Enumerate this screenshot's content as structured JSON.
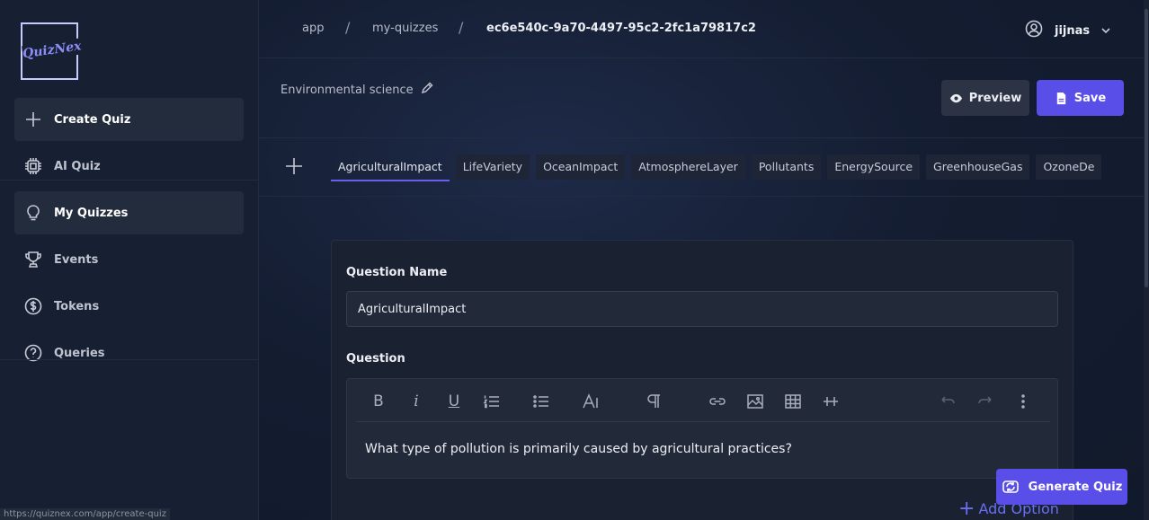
{
  "app": {
    "logo_text": "QuizNex"
  },
  "sidebar": {
    "items": [
      {
        "label": "Create Quiz",
        "icon": "plus-icon"
      },
      {
        "label": "AI Quiz",
        "icon": "cpu-icon"
      },
      {
        "label": "My Quizzes",
        "icon": "lightbulb-icon"
      },
      {
        "label": "Events",
        "icon": "trophy-icon"
      },
      {
        "label": "Tokens",
        "icon": "dollar-icon"
      },
      {
        "label": "Queries",
        "icon": "question-icon"
      }
    ],
    "active": "My Quizzes"
  },
  "breadcrumb": {
    "items": [
      "app",
      "my-quizzes",
      "ec6e540c-9a70-4497-95c2-2fc1a79817c2"
    ],
    "separator": "/"
  },
  "user": {
    "name": "jijnas"
  },
  "quiz": {
    "title": "Environmental science"
  },
  "actions": {
    "preview_label": "Preview",
    "save_label": "Save",
    "generate_label": "Generate Quiz"
  },
  "tabs": [
    "AgriculturalImpact",
    "LifeVariety",
    "OceanImpact",
    "AtmosphereLayer",
    "Pollutants",
    "EnergySource",
    "GreenhouseGas",
    "OzoneDe"
  ],
  "active_tab": "AgriculturalImpact",
  "question_form": {
    "name_label": "Question Name",
    "name_value": "AgriculturalImpact",
    "question_label": "Question",
    "question_text": "What type of pollution is primarily caused by agricultural practices?",
    "add_option_label": "Add Option"
  },
  "status_url": "https://quiznex.com/app/create-quiz",
  "colors": {
    "accent": "#5a4ee8",
    "background": "#121a2b",
    "sidebar": "#172033"
  }
}
